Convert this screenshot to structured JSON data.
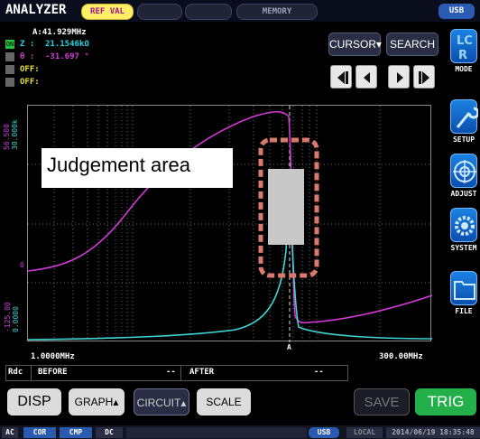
{
  "app": {
    "title": "ANALYZER"
  },
  "tabs": {
    "ref": "REF VAL",
    "blank1": "",
    "blank2": "",
    "memory": "MEMORY",
    "usb": "USB"
  },
  "readouts": {
    "freq": "A:41.929MHz",
    "r1": {
      "badge": "ON",
      "param": "Z :",
      "value": "21.1546kΩ"
    },
    "r2": {
      "param": "θ :",
      "value": "-31.697 °"
    },
    "r3": {
      "param": "OFF:"
    },
    "r4": {
      "param": "OFF:"
    }
  },
  "controls": {
    "cursor": "CURSOR▾",
    "search": "SEARCH"
  },
  "side_menu": [
    {
      "label": "MODE",
      "icon": "LCR"
    },
    {
      "label": "SETUP",
      "icon": "wrench"
    },
    {
      "label": "ADJUST",
      "icon": "target"
    },
    {
      "label": "SYSTEM",
      "icon": "gear"
    },
    {
      "label": "FILE",
      "icon": "folder"
    }
  ],
  "graph": {
    "y_top_magenta": "56.500",
    "y_top_cyan": "30.000k",
    "y_mid_magenta": "0",
    "y_bot_magenta": "-125.00",
    "y_bot_cyan": "0.0000",
    "x_start": "1.0000MHz",
    "x_end": "300.00MHz",
    "cursor_label": "A",
    "annotation": "Judgement area"
  },
  "info": {
    "rdc": "Rdc",
    "before": "BEFORE",
    "before_val": "--",
    "after": "AFTER",
    "after_val": "--"
  },
  "bottom_buttons": {
    "disp": "DISP",
    "graph": "GRAPH▴",
    "circuit": "CIRCUIT▴",
    "scale": "SCALE",
    "save": "SAVE",
    "trig": "TRIG"
  },
  "status": {
    "ac": "AC",
    "cor": "COR",
    "cmp": "CMP",
    "dc": "DC",
    "usb": "USB",
    "local": "LOCAL",
    "datetime": "2014/06/19 18:35:48"
  },
  "colors": {
    "magenta": "#d13ad6",
    "cyan": "#3fd3d3",
    "trig": "#23b04a",
    "judge_box": "#d97a6c"
  }
}
